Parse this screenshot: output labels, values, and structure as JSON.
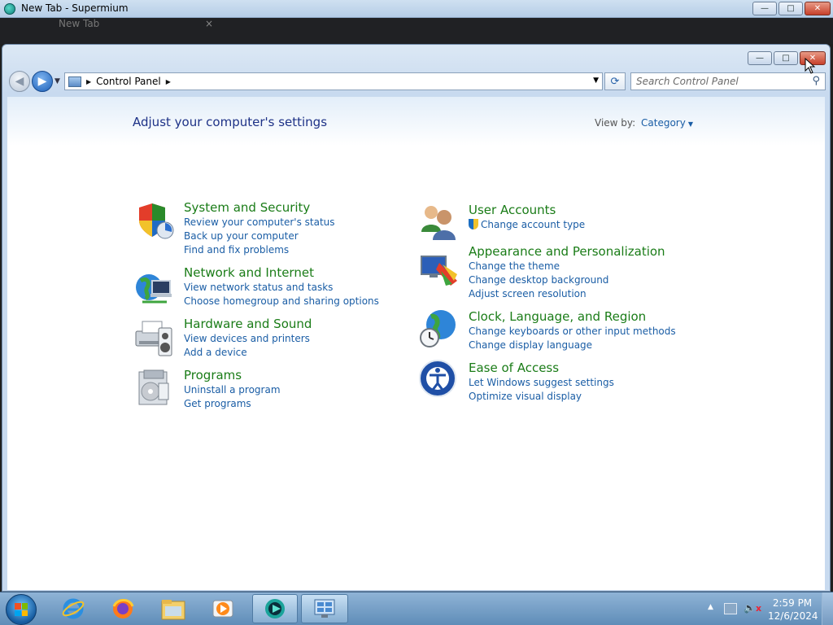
{
  "browser": {
    "window_title": "New Tab - Supermium",
    "tab_title": "New Tab",
    "tab_close": "×"
  },
  "window_controls": {
    "minimize": "—",
    "maximize": "□",
    "close": "✕"
  },
  "nav": {
    "back_glyph": "◀",
    "forward_glyph": "▶",
    "breadcrumb": "Control Panel",
    "refresh_glyph": "⟳",
    "search_placeholder": "Search Control Panel"
  },
  "header": {
    "title": "Adjust your computer's settings",
    "view_by_label": "View by:",
    "view_by_value": "Category"
  },
  "categories_left": [
    {
      "heading": "System and Security",
      "links": [
        "Review your computer's status",
        "Back up your computer",
        "Find and fix problems"
      ],
      "icon": "shield-icon"
    },
    {
      "heading": "Network and Internet",
      "links": [
        "View network status and tasks",
        "Choose homegroup and sharing options"
      ],
      "icon": "globe-network-icon"
    },
    {
      "heading": "Hardware and Sound",
      "links": [
        "View devices and printers",
        "Add a device"
      ],
      "icon": "printer-speaker-icon"
    },
    {
      "heading": "Programs",
      "links": [
        "Uninstall a program",
        "Get programs"
      ],
      "icon": "programs-icon"
    }
  ],
  "categories_right": [
    {
      "heading": "User Accounts",
      "links": [
        "Change account type"
      ],
      "icon": "users-icon"
    },
    {
      "heading": "Appearance and Personalization",
      "links": [
        "Change the theme",
        "Change desktop background",
        "Adjust screen resolution"
      ],
      "icon": "monitor-palette-icon"
    },
    {
      "heading": "Clock, Language, and Region",
      "links": [
        "Change keyboards or other input methods",
        "Change display language"
      ],
      "icon": "globe-clock-icon"
    },
    {
      "heading": "Ease of Access",
      "links": [
        "Let Windows suggest settings",
        "Optimize visual display"
      ],
      "icon": "ease-of-access-icon"
    }
  ],
  "taskbar": {
    "items": [
      "start-orb",
      "internet-explorer-icon",
      "firefox-icon",
      "file-explorer-icon",
      "media-player-icon",
      "supermium-icon",
      "control-panel-icon"
    ],
    "active_items": [
      "supermium-icon",
      "control-panel-icon"
    ],
    "clock_time": "2:59 PM",
    "clock_date": "12/6/2024"
  },
  "colors": {
    "heading_green": "#1a7c17",
    "link_blue": "#1a5da5",
    "title_blue": "#1e3287"
  }
}
